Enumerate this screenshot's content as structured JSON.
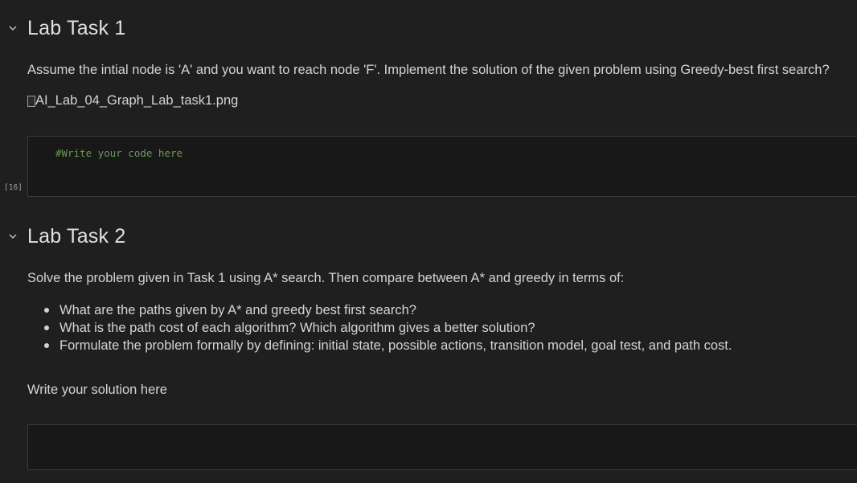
{
  "task1": {
    "heading": "Lab Task 1",
    "description": "Assume the intial node is 'A' and you want to reach node 'F'. Implement the solution of the given problem using Greedy-best first search?",
    "image_alt": "AI_Lab_04_Graph_Lab_task1.png",
    "code": "#Write your code here",
    "execution_count": "[16]"
  },
  "task2": {
    "heading": "Lab Task 2",
    "description": "Solve the problem given in Task 1 using A* search. Then compare between A* and greedy in terms of:",
    "bullets": [
      "What are the paths given by A* and greedy best first search?",
      "What is the path cost of each algorithm? Which algorithm gives a better solution?",
      "Formulate the problem formally by defining: initial state, possible actions, transition model, goal test, and path cost."
    ],
    "solution_prompt": "Write your solution here"
  },
  "colors": {
    "background": "#1f1f1f",
    "cell_background": "#181818",
    "comment": "#6a9955",
    "text": "#d4d4d4"
  },
  "icons": {
    "collapse": "chevron-down-icon",
    "broken_image": "broken-image-icon"
  }
}
